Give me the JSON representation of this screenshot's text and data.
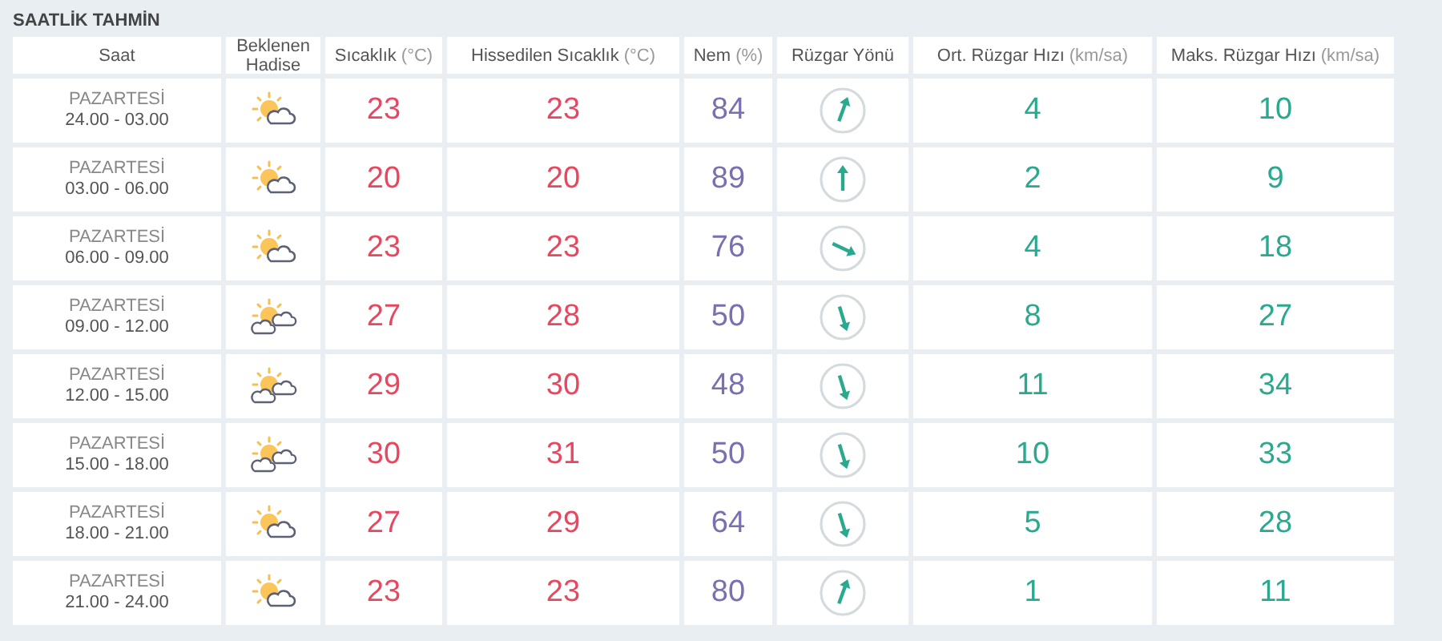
{
  "title": "SAATLİK TAHMİN",
  "columns": [
    {
      "label": "Saat"
    },
    {
      "label": "Beklenen Hadise"
    },
    {
      "label": "Sıcaklık",
      "unit": "(°C)"
    },
    {
      "label": "Hissedilen Sıcaklık",
      "unit": "(°C)"
    },
    {
      "label": "Nem",
      "unit": "(%)"
    },
    {
      "label": "Rüzgar Yönü"
    },
    {
      "label": "Ort. Rüzgar Hızı",
      "unit": "(km/sa)"
    },
    {
      "label": "Maks. Rüzgar Hızı",
      "unit": "(km/sa)"
    }
  ],
  "rows": [
    {
      "day": "PAZARTESİ",
      "time": "24.00 - 03.00",
      "weather_icon": {
        "kind": "suncloud"
      },
      "temp": "23",
      "feels": "23",
      "humidity": "84",
      "wind_arrow": {
        "kind": "nne"
      },
      "avg_wind": "4",
      "max_wind": "10"
    },
    {
      "day": "PAZARTESİ",
      "time": "03.00 - 06.00",
      "weather_icon": {
        "kind": "suncloud"
      },
      "temp": "20",
      "feels": "20",
      "humidity": "89",
      "wind_arrow": {
        "kind": "n"
      },
      "avg_wind": "2",
      "max_wind": "9"
    },
    {
      "day": "PAZARTESİ",
      "time": "06.00 - 09.00",
      "weather_icon": {
        "kind": "suncloud"
      },
      "temp": "23",
      "feels": "23",
      "humidity": "76",
      "wind_arrow": {
        "kind": "ese"
      },
      "avg_wind": "4",
      "max_wind": "18"
    },
    {
      "day": "PAZARTESİ",
      "time": "09.00 - 12.00",
      "weather_icon": {
        "kind": "sunclouds"
      },
      "temp": "27",
      "feels": "28",
      "humidity": "50",
      "wind_arrow": {
        "kind": "sse"
      },
      "avg_wind": "8",
      "max_wind": "27"
    },
    {
      "day": "PAZARTESİ",
      "time": "12.00 - 15.00",
      "weather_icon": {
        "kind": "sunclouds"
      },
      "temp": "29",
      "feels": "30",
      "humidity": "48",
      "wind_arrow": {
        "kind": "sse"
      },
      "avg_wind": "11",
      "max_wind": "34"
    },
    {
      "day": "PAZARTESİ",
      "time": "15.00 - 18.00",
      "weather_icon": {
        "kind": "sunclouds"
      },
      "temp": "30",
      "feels": "31",
      "humidity": "50",
      "wind_arrow": {
        "kind": "sse"
      },
      "avg_wind": "10",
      "max_wind": "33"
    },
    {
      "day": "PAZARTESİ",
      "time": "18.00 - 21.00",
      "weather_icon": {
        "kind": "suncloud"
      },
      "temp": "27",
      "feels": "29",
      "humidity": "64",
      "wind_arrow": {
        "kind": "sse"
      },
      "avg_wind": "5",
      "max_wind": "28"
    },
    {
      "day": "PAZARTESİ",
      "time": "21.00 - 24.00",
      "weather_icon": {
        "kind": "suncloud"
      },
      "temp": "23",
      "feels": "23",
      "humidity": "80",
      "wind_arrow": {
        "kind": "nne"
      },
      "avg_wind": "1",
      "max_wind": "11"
    }
  ]
}
